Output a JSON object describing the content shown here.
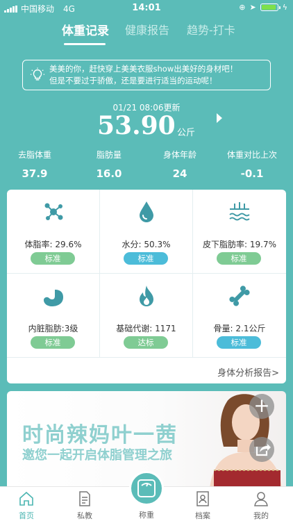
{
  "status_bar": {
    "carrier": "中国移动",
    "network": "4G",
    "time": "14:01",
    "battery_level": 0.9
  },
  "tabs": [
    {
      "label": "体重记录",
      "active": true
    },
    {
      "label": "健康报告",
      "active": false
    },
    {
      "label": "趋势-打卡",
      "active": false
    }
  ],
  "tip": {
    "line1": "美美的你，赶快穿上美美衣服show出美好的身材吧！",
    "line2": "但是不要过于骄傲，还是要进行适当的运动呢！"
  },
  "weight": {
    "updated": "01/21 08:06更新",
    "value": "53.90",
    "unit": "公斤"
  },
  "stats": [
    {
      "label": "去脂体重",
      "value": "37.9"
    },
    {
      "label": "脂肪量",
      "value": "16.0"
    },
    {
      "label": "身体年龄",
      "value": "24"
    },
    {
      "label": "体重对比上次",
      "value": "-0.1"
    }
  ],
  "metrics": [
    {
      "label": "体脂率: 29.6%",
      "badge": "标准",
      "badge_color": "#7fcb94",
      "icon": "molecule-icon"
    },
    {
      "label": "水分: 50.3%",
      "badge": "标准",
      "badge_color": "#4cbcd9",
      "icon": "water-drop-icon"
    },
    {
      "label": "皮下脂肪率: 19.7%",
      "badge": "标准",
      "badge_color": "#7fcb94",
      "icon": "skin-layer-icon"
    },
    {
      "label": "内脏脂肪:3级",
      "badge": "标准",
      "badge_color": "#7fcb94",
      "icon": "stomach-icon"
    },
    {
      "label": "基础代谢: 1171",
      "badge": "达标",
      "badge_color": "#7fcb94",
      "icon": "flame-icon"
    },
    {
      "label": "骨量: 2.1公斤",
      "badge": "标准",
      "badge_color": "#4cbcd9",
      "icon": "bone-icon"
    }
  ],
  "report_link": "身体分析报告>",
  "ad": {
    "title": "时尚辣妈叶一茜",
    "subtitle": "邀您一起开启体脂管理之旅"
  },
  "nav": [
    {
      "label": "首页",
      "icon": "home-icon",
      "active": true
    },
    {
      "label": "私教",
      "icon": "document-icon",
      "active": false
    },
    {
      "label": "称重",
      "icon": "scale-icon",
      "active": false
    },
    {
      "label": "档案",
      "icon": "profile-card-icon",
      "active": false
    },
    {
      "label": "我的",
      "icon": "user-icon",
      "active": false
    }
  ],
  "colors": {
    "primary": "#5bbcb8",
    "badge_green": "#7fcb94",
    "badge_blue": "#4cbcd9",
    "icon_teal": "#3f9aa6"
  }
}
